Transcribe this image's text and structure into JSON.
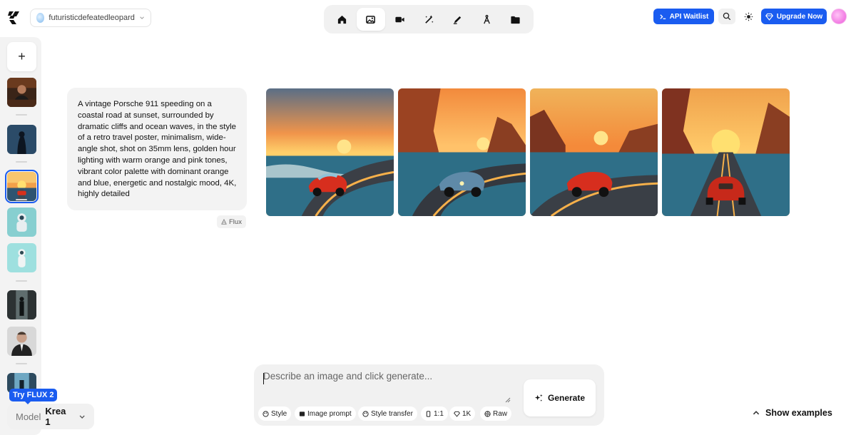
{
  "header": {
    "workspace_name": "futuristicdefeatedleopard",
    "nav": [
      "home-icon",
      "image-icon",
      "video-icon",
      "enhance-icon",
      "edit-icon",
      "train-icon",
      "folder-icon"
    ],
    "active_nav": "image-icon",
    "api_label": "API Waitlist",
    "upgrade_label": "Upgrade Now",
    "accent_color": "#1a5cf0"
  },
  "sidebar": {
    "new_label": "+",
    "history": [
      "man at desk",
      "hooded figure",
      "orange sunset car",
      "astronaut",
      "astronaut in water",
      "figure in cave",
      "man portrait",
      "blue cave figure"
    ],
    "selected_index": 2,
    "flux_badge": "Try FLUX 2",
    "model_label": "Model",
    "model_value": "Krea 1"
  },
  "result": {
    "prompt": "A vintage Porsche 911 speeding on a coastal road at sunset, surrounded by dramatic cliffs and ocean waves, in the style of a retro travel poster, minimalism, wide-angle shot, shot on 35mm lens, golden hour lighting with warm orange and pink tones, vibrant color palette with dominant orange and blue, energetic and nostalgic mood, 4K, highly detailed",
    "model_tag": "Flux",
    "images": [
      "red car on coastal road",
      "blue car on coastal road",
      "red car near sea",
      "red car rear view toward sunset"
    ]
  },
  "composer": {
    "placeholder": "Describe an image and click generate...",
    "chips": [
      "Style",
      "Image prompt",
      "Style transfer",
      "1:1",
      "1K",
      "Raw"
    ],
    "generate_label": "Generate"
  },
  "footer": {
    "show_examples": "Show examples"
  }
}
